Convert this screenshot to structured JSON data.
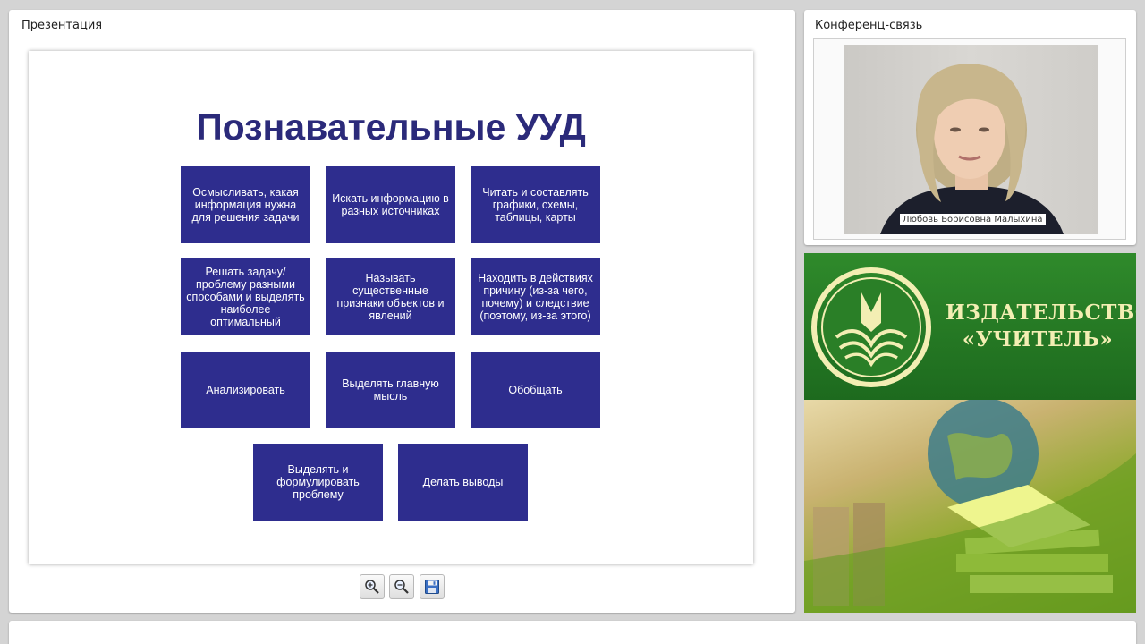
{
  "presentation": {
    "title": "Презентация",
    "slide": {
      "title": "Познавательные УУД",
      "tiles": [
        "Осмысливать, какая информация нужна для решения задачи",
        "Искать информацию в разных источниках",
        "Читать и составлять графики, схемы, таблицы, карты",
        "Решать задачу/проблему разными способами и выделять наиболее оптимальный",
        "Называть существенные признаки объектов и явлений",
        "Находить в действиях причину (из-за чего, почему) и следствие (поэтому, из-за этого)",
        "Анализировать",
        "Выделять главную мысль",
        "Обобщать",
        "Выделять и формулировать проблему",
        "Делать выводы"
      ],
      "tile_color": "#2e2d8e",
      "title_color": "#2b2a7a"
    },
    "toolbar": [
      {
        "name": "zoom-in",
        "icon": "zoom-in-icon"
      },
      {
        "name": "zoom-out",
        "icon": "zoom-out-icon"
      },
      {
        "name": "save",
        "icon": "save-icon"
      }
    ]
  },
  "conference": {
    "title": "Конференц-связь",
    "speaker_name": "Любовь Борисовна Малыхина"
  },
  "banner": {
    "publisher_line1": "ИЗДАТЕЛЬСТВО",
    "publisher_line2": "«УЧИТЕЛЬ»",
    "text_color": "#f3eeb3"
  }
}
